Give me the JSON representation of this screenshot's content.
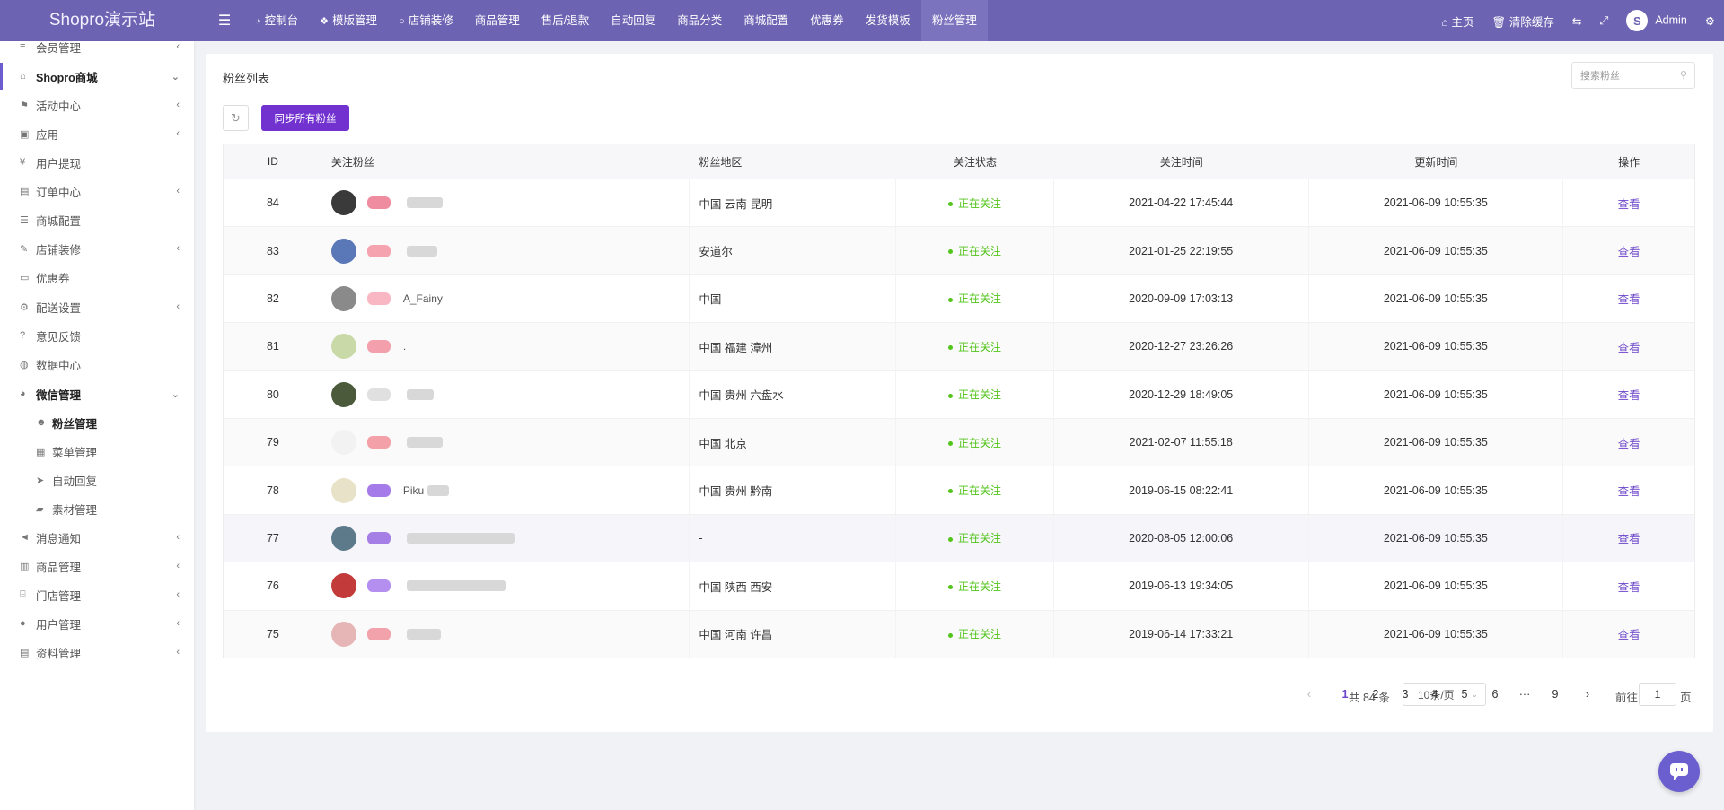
{
  "app": {
    "title": "Shopro演示站"
  },
  "topnav": [
    {
      "label": "控制台",
      "icon": "dashboard-icon"
    },
    {
      "label": "模版管理",
      "icon": "cubes-icon"
    },
    {
      "label": "店铺装修",
      "icon": "circle-icon"
    },
    {
      "label": "商品管理"
    },
    {
      "label": "售后/退款"
    },
    {
      "label": "自动回复"
    },
    {
      "label": "商品分类"
    },
    {
      "label": "商城配置"
    },
    {
      "label": "优惠券"
    },
    {
      "label": "发货模板"
    },
    {
      "label": "粉丝管理",
      "active": true
    }
  ],
  "topright": {
    "home": "主页",
    "clear_cache": "清除缓存",
    "user": "Admin"
  },
  "sidebar": {
    "items": [
      {
        "label": "会员管理",
        "arrow": "‹",
        "type": "item",
        "icon": "list-icon"
      },
      {
        "label": "Shopro商城",
        "arrow": "⌄",
        "type": "group-shop",
        "icon": "home-icon"
      },
      {
        "label": "活动中心",
        "arrow": "‹",
        "type": "item",
        "icon": "flag-icon"
      },
      {
        "label": "应用",
        "arrow": "‹",
        "type": "item",
        "icon": "briefcase-icon"
      },
      {
        "label": "用户提现",
        "arrow": "",
        "type": "item",
        "icon": "yen-icon"
      },
      {
        "label": "订单中心",
        "arrow": "‹",
        "type": "item",
        "icon": "file-icon"
      },
      {
        "label": "商城配置",
        "arrow": "",
        "type": "item",
        "icon": "sliders-icon"
      },
      {
        "label": "店铺装修",
        "arrow": "‹",
        "type": "item",
        "icon": "brush-icon"
      },
      {
        "label": "优惠券",
        "arrow": "",
        "type": "item",
        "icon": "ticket-icon"
      },
      {
        "label": "配送设置",
        "arrow": "‹",
        "type": "item",
        "icon": "gears-icon"
      },
      {
        "label": "意见反馈",
        "arrow": "",
        "type": "item",
        "icon": "question-icon"
      },
      {
        "label": "数据中心",
        "arrow": "",
        "type": "item",
        "icon": "chart-icon"
      },
      {
        "label": "微信管理",
        "arrow": "⌄",
        "type": "group",
        "icon": "wechat-icon"
      },
      {
        "label": "粉丝管理",
        "arrow": "",
        "type": "sub-active",
        "icon": "users-icon"
      },
      {
        "label": "菜单管理",
        "arrow": "",
        "type": "sub",
        "icon": "menu-icon"
      },
      {
        "label": "自动回复",
        "arrow": "",
        "type": "sub",
        "icon": "send-icon"
      },
      {
        "label": "素材管理",
        "arrow": "",
        "type": "sub",
        "icon": "folder-icon"
      },
      {
        "label": "消息通知",
        "arrow": "‹",
        "type": "item",
        "icon": "bullhorn-icon"
      },
      {
        "label": "商品管理",
        "arrow": "‹",
        "type": "item",
        "icon": "archive-icon"
      },
      {
        "label": "门店管理",
        "arrow": "‹",
        "type": "item",
        "icon": "bank-icon"
      },
      {
        "label": "用户管理",
        "arrow": "‹",
        "type": "item",
        "icon": "user-icon"
      },
      {
        "label": "资料管理",
        "arrow": "‹",
        "type": "item",
        "icon": "file-alt-icon"
      }
    ]
  },
  "panel": {
    "title": "粉丝列表",
    "search_placeholder": "搜索粉丝",
    "sync_button": "同步所有粉丝"
  },
  "table": {
    "headers": [
      "ID",
      "关注粉丝",
      "粉丝地区",
      "关注状态",
      "关注时间",
      "更新时间",
      "操作"
    ],
    "rows": [
      {
        "id": "84",
        "nick": "",
        "region": "中国 云南 昆明",
        "status": "正在关注",
        "subscribe_time": "2021-04-22 17:45:44",
        "update_time": "2021-06-09 10:55:35",
        "action": "查看",
        "avatar_color": "#3a3a3a",
        "tag_color": "#f08ca0"
      },
      {
        "id": "83",
        "nick": "",
        "region": "安道尔",
        "status": "正在关注",
        "subscribe_time": "2021-01-25 22:19:55",
        "update_time": "2021-06-09 10:55:35",
        "action": "查看",
        "avatar_color": "#5a78b8",
        "tag_color": "#f6a3b0"
      },
      {
        "id": "82",
        "nick": "A_Fainy",
        "region": "中国",
        "status": "正在关注",
        "subscribe_time": "2020-09-09 17:03:13",
        "update_time": "2021-06-09 10:55:35",
        "action": "查看",
        "avatar_color": "#8a8a8a",
        "tag_color": "#f8b7c2"
      },
      {
        "id": "81",
        "nick": ".",
        "region": "中国 福建 漳州",
        "status": "正在关注",
        "subscribe_time": "2020-12-27 23:26:26",
        "update_time": "2021-06-09 10:55:35",
        "action": "查看",
        "avatar_color": "#c9d9a8",
        "tag_color": "#f4a0ac"
      },
      {
        "id": "80",
        "nick": "",
        "region": "中国 贵州 六盘水",
        "status": "正在关注",
        "subscribe_time": "2020-12-29 18:49:05",
        "update_time": "2021-06-09 10:55:35",
        "action": "查看",
        "avatar_color": "#4c5a3c",
        "tag_color": "#e0e0e0"
      },
      {
        "id": "79",
        "nick": "",
        "region": "中国 北京",
        "status": "正在关注",
        "subscribe_time": "2021-02-07 11:55:18",
        "update_time": "2021-06-09 10:55:35",
        "action": "查看",
        "avatar_color": "#f2f2f2",
        "tag_color": "#f3a0a8"
      },
      {
        "id": "78",
        "nick": "Piku",
        "region": "中国 贵州 黔南",
        "status": "正在关注",
        "subscribe_time": "2019-06-15 08:22:41",
        "update_time": "2021-06-09 10:55:35",
        "action": "查看",
        "avatar_color": "#e8e2c8",
        "tag_color": "#a47be8"
      },
      {
        "id": "77",
        "nick": "",
        "region": "-",
        "status": "正在关注",
        "subscribe_time": "2020-08-05 12:00:06",
        "update_time": "2021-06-09 10:55:35",
        "action": "查看",
        "avatar_color": "#5d7a8a",
        "tag_color": "#a57ee6"
      },
      {
        "id": "76",
        "nick": "",
        "region": "中国 陕西 西安",
        "status": "正在关注",
        "subscribe_time": "2019-06-13 19:34:05",
        "update_time": "2021-06-09 10:55:35",
        "action": "查看",
        "avatar_color": "#c23a3a",
        "tag_color": "#b48ff0"
      },
      {
        "id": "75",
        "nick": "",
        "region": "中国 河南 许昌",
        "status": "正在关注",
        "subscribe_time": "2019-06-14 17:33:21",
        "update_time": "2021-06-09 10:55:35",
        "action": "查看",
        "avatar_color": "#e6b6b6",
        "tag_color": "#f2a2aa"
      }
    ]
  },
  "pagination": {
    "total": "共 84 条",
    "page_size": "10条/页",
    "pages": [
      "1",
      "2",
      "3",
      "4",
      "5",
      "6",
      "···",
      "9"
    ],
    "current": "1",
    "goto_prefix": "前往",
    "goto_value": "1",
    "goto_suffix": "页"
  },
  "colors": {
    "topbar": "#6c63b2",
    "accent": "#7232d0",
    "status_green": "#52c41a",
    "link": "#6c45c9"
  }
}
